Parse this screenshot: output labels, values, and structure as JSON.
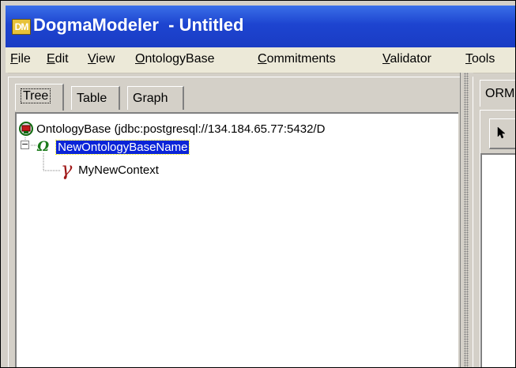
{
  "window": {
    "app_icon_text": "DM",
    "title": "DogmaModeler  - Untitled"
  },
  "menu": {
    "items": [
      {
        "label": "File"
      },
      {
        "label": "Edit"
      },
      {
        "label": "View"
      },
      {
        "label": "OntologyBase"
      },
      {
        "label": "Commitments"
      },
      {
        "label": "Validator"
      },
      {
        "label": "Tools"
      }
    ]
  },
  "left_panel": {
    "tabs": [
      {
        "label": "Tree",
        "active": true
      },
      {
        "label": "Table",
        "active": false
      },
      {
        "label": "Graph",
        "active": false
      }
    ],
    "tree": {
      "root": {
        "label": "OntologyBase (jdbc:postgresql://134.184.65.77:5432/D",
        "icon": "ontology-base-icon"
      },
      "ontology": {
        "label": "NewOntologyBaseName",
        "icon": "omega-icon",
        "selected": true,
        "expander": "⊟"
      },
      "context": {
        "label": "MyNewContext",
        "icon": "gamma-icon"
      }
    }
  },
  "right_panel": {
    "tab_label": "ORM",
    "tool_icon": "pointer-arrow-icon"
  },
  "colors": {
    "title_bar": "#1d44d0",
    "selection": "#0a24d8",
    "omega": "#1a7a1a",
    "gamma": "#a01818"
  }
}
